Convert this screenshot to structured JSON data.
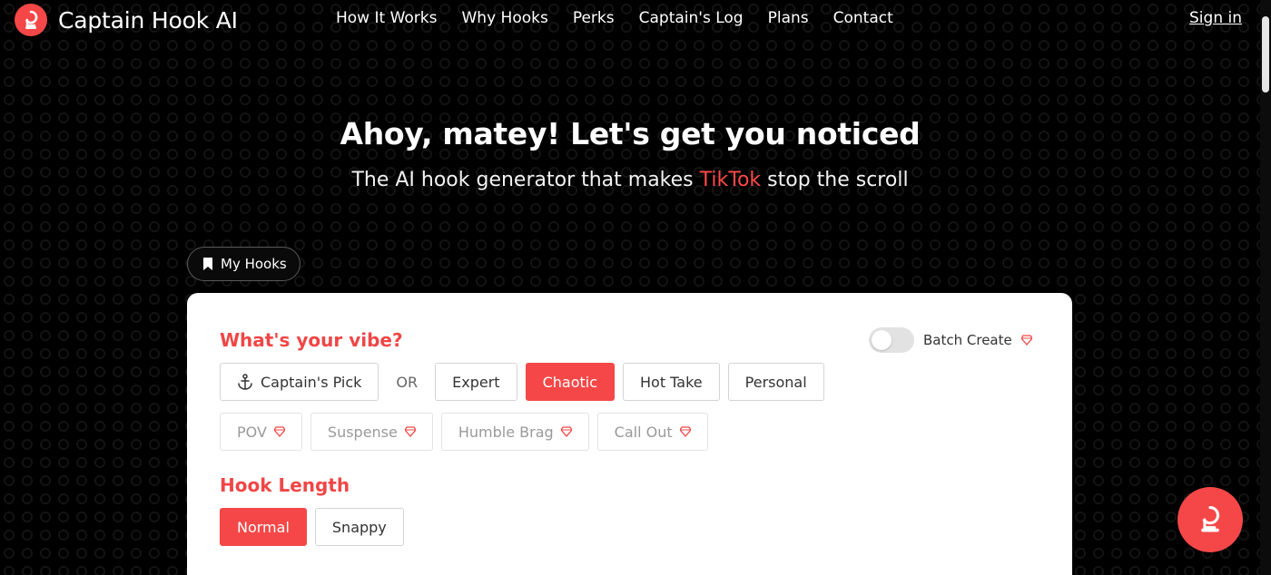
{
  "brand": {
    "name": "Captain Hook AI"
  },
  "nav": {
    "links": [
      "How It Works",
      "Why Hooks",
      "Perks",
      "Captain's Log",
      "Plans",
      "Contact"
    ],
    "signin": "Sign in"
  },
  "hero": {
    "title": "Ahoy, matey! Let's get you noticed",
    "subtitle_pre": "The AI hook generator that makes ",
    "subtitle_accent": "TikTok",
    "subtitle_post": " stop the scroll"
  },
  "my_hooks": {
    "label": "My Hooks"
  },
  "vibe": {
    "title": "What's your vibe?",
    "batch_label": "Batch Create",
    "or_label": "OR",
    "captains_pick": "Captain's Pick",
    "options": [
      "Expert",
      "Chaotic",
      "Hot Take",
      "Personal"
    ],
    "selected": "Chaotic",
    "premium_options": [
      "POV",
      "Suspense",
      "Humble Brag",
      "Call Out"
    ]
  },
  "hook_length": {
    "title": "Hook Length",
    "options": [
      "Normal",
      "Snappy"
    ],
    "selected": "Normal"
  },
  "colors": {
    "accent": "#f54747",
    "background": "#000000",
    "card": "#ffffff"
  },
  "icons": {
    "logo": "captain-hook-logo-icon",
    "bookmark": "bookmark-icon",
    "anchor": "anchor-icon",
    "premium": "gem-icon"
  }
}
